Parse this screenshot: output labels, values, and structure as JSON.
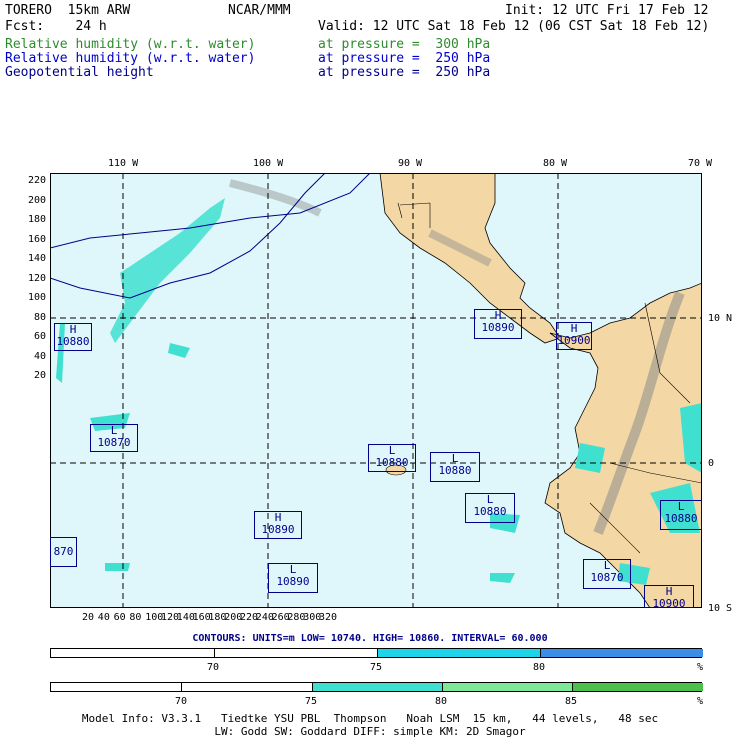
{
  "header": {
    "line1_left": "TORERO  15km ARW",
    "line1_mid": "NCAR/MMM",
    "line1_right": "Init: 12 UTC Fri 17 Feb 12",
    "line2_left": "Fcst:    24 h",
    "line2_right": "Valid: 12 UTC Sat 18 Feb 12 (06 CST Sat 18 Feb 12)",
    "fields": [
      {
        "name": "Relative humidity (w.r.t. water)",
        "level": "at pressure =  300 hPa",
        "color": "#2e8b2e"
      },
      {
        "name": "Relative humidity (w.r.t. water)",
        "level": "at pressure =  250 hPa",
        "color": "#0000cd"
      },
      {
        "name": "Geopotential height",
        "level": "at pressure =  250 hPa",
        "color": "#00008b"
      }
    ]
  },
  "axes": {
    "lon_labels": [
      "110 W",
      "100 W",
      "90 W",
      "80 W",
      "70 W"
    ],
    "lat_labels": [
      "10 N",
      "0",
      "10 S"
    ],
    "x_ticks": [
      "20",
      "40",
      "60",
      "80",
      "100",
      "120",
      "140",
      "160",
      "180",
      "200",
      "220",
      "240",
      "260",
      "280",
      "300",
      "320"
    ],
    "y_ticks": [
      "220",
      "200",
      "180",
      "160",
      "140",
      "120",
      "100",
      "80",
      "60",
      "40",
      "20"
    ]
  },
  "height_centers": [
    {
      "type": "H",
      "value": "10880"
    },
    {
      "type": "L",
      "value": "10870"
    },
    {
      "type": "H",
      "value": "10890"
    },
    {
      "type": "L",
      "value": "10890"
    },
    {
      "type": "L",
      "value": "10880"
    },
    {
      "type": "L",
      "value": "10880"
    },
    {
      "type": "L",
      "value": "10880"
    },
    {
      "type": "H",
      "value": "10890"
    },
    {
      "type": "H",
      "value": "10900"
    },
    {
      "type": "L",
      "value": "10880"
    },
    {
      "type": "L",
      "value": "10870"
    },
    {
      "type": "H",
      "value": "10900"
    },
    {
      "type": "",
      "value": "870"
    }
  ],
  "contours_line": "CONTOURS:  UNITS=m  LOW=  10740.     HIGH=  10860.     INTERVAL=  60.000",
  "colorbar1": {
    "labels": [
      "70",
      "75",
      "80"
    ],
    "unit": "%",
    "colors": [
      "#ffffff",
      "#ffffff",
      "#1fd3e8",
      "#3a8ee8"
    ]
  },
  "colorbar2": {
    "labels": [
      "70",
      "75",
      "80",
      "85"
    ],
    "unit": "%",
    "colors": [
      "#ffffff",
      "#ffffff",
      "#40e0d0",
      "#7de89a",
      "#4cc04c"
    ]
  },
  "footer": {
    "line1": "Model Info: V3.3.1   Tiedtke YSU PBL  Thompson   Noah LSM  15 km,   44 levels,   48 sec",
    "line2": "LW: Godd SW: Goddard DIFF: simple KM: 2D Smagor"
  }
}
